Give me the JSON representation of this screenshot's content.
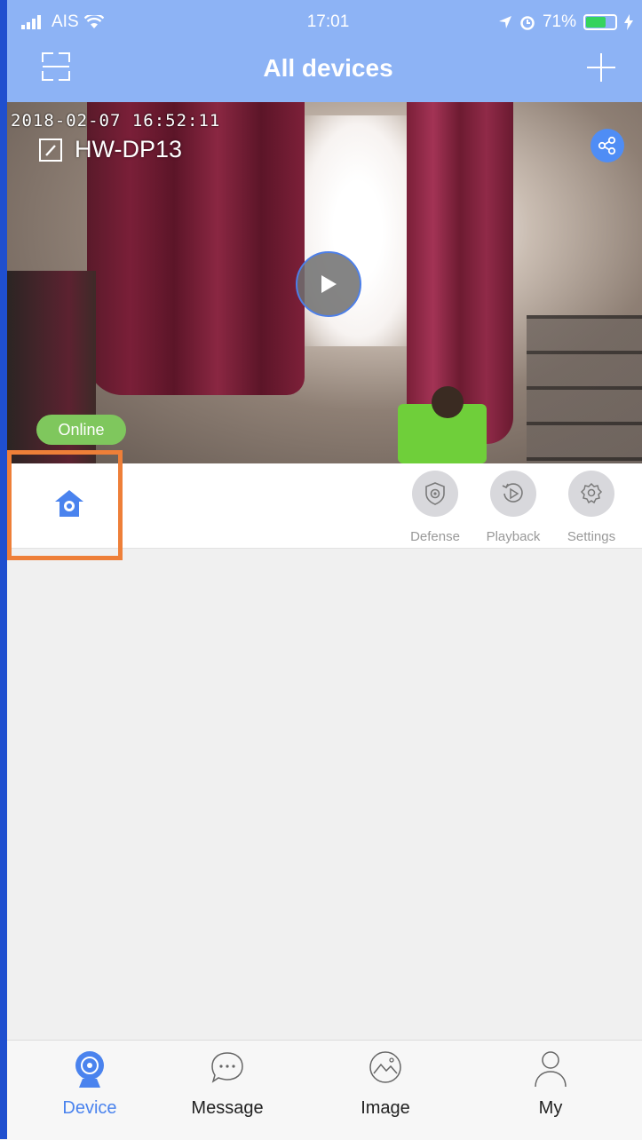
{
  "status_bar": {
    "carrier": "AIS",
    "time": "17:01",
    "battery_percent": "71%",
    "battery_level": 0.71
  },
  "nav": {
    "title": "All devices",
    "scan_icon": "scan-icon",
    "add_icon": "plus-icon"
  },
  "device": {
    "timestamp": "2018-02-07  16:52:11",
    "name": "HW-DP13",
    "status": "Online",
    "status_color": "#7fc75d",
    "share_icon": "share-icon",
    "play_icon": "play-icon"
  },
  "actions": [
    {
      "label": "Defense",
      "icon": "defense-icon"
    },
    {
      "label": "Playback",
      "icon": "playback-icon"
    },
    {
      "label": "Settings",
      "icon": "settings-icon"
    }
  ],
  "tabs": [
    {
      "label": "Device",
      "icon": "camera-icon",
      "active": true
    },
    {
      "label": "Message",
      "icon": "message-icon",
      "active": false
    },
    {
      "label": "Image",
      "icon": "image-icon",
      "active": false
    },
    {
      "label": "My",
      "icon": "user-icon",
      "active": false
    }
  ],
  "colors": {
    "header": "#8db3f5",
    "accent": "#4a83ee",
    "highlight": "#ee7f38"
  }
}
